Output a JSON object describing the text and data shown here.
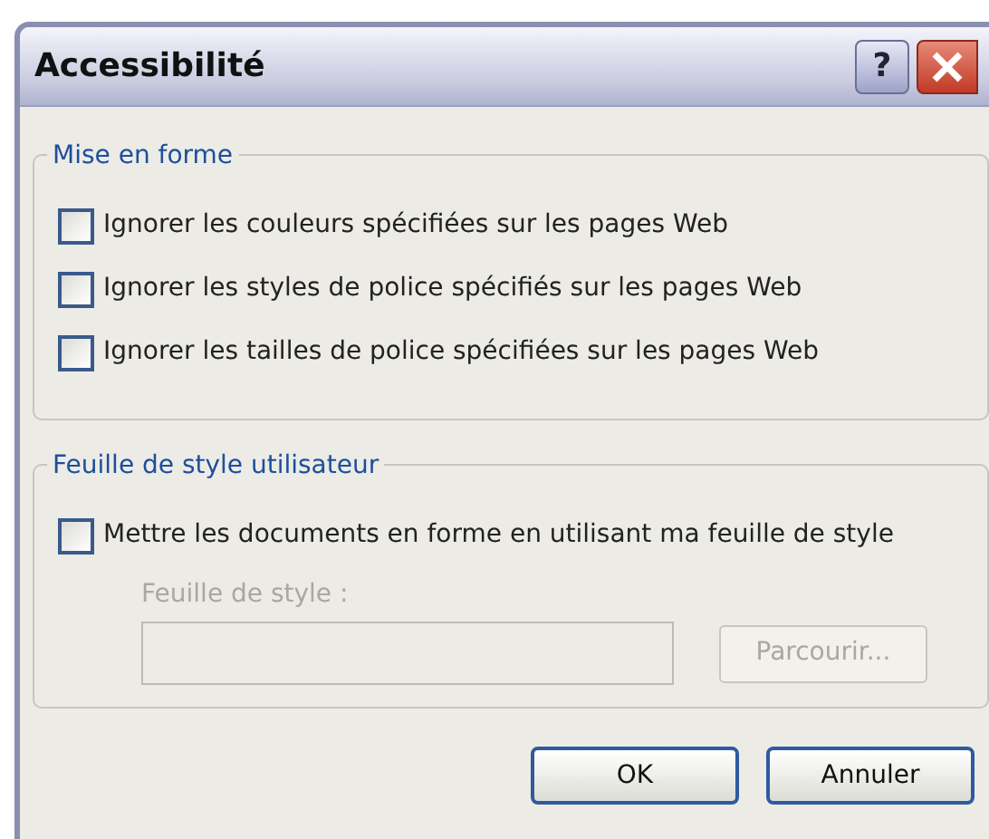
{
  "window": {
    "title": "Accessibilité",
    "help": "?"
  },
  "groups": [
    {
      "legend": "Mise en forme",
      "options": [
        {
          "label": "Ignorer les couleurs spécifiées sur les pages Web",
          "checked": false
        },
        {
          "label": "Ignorer les styles de police spécifiés sur les pages Web",
          "checked": false
        },
        {
          "label": "Ignorer les tailles de police spécifiées sur les pages Web",
          "checked": false
        }
      ]
    },
    {
      "legend": "Feuille de style utilisateur",
      "options": [
        {
          "label": "Mettre les documents en forme en utilisant ma feuille de style",
          "checked": false
        }
      ],
      "stylesheet": {
        "label": "Feuille de style :",
        "disabled": true,
        "browse": "Parcourir..."
      }
    }
  ],
  "buttons": [
    "OK",
    "Annuler"
  ]
}
